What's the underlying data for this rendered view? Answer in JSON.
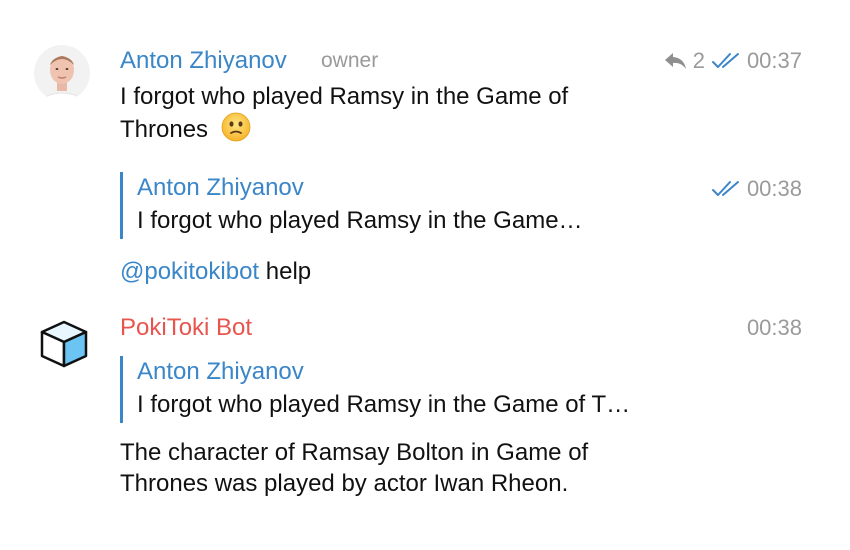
{
  "messages": [
    {
      "author": "Anton Zhiyanov",
      "role": "owner",
      "reply_count": "2",
      "time": "00:37",
      "text_line1": "I forgot who played Ramsy in the Game of",
      "text_line2": "Thrones",
      "emoji": "confused-face-emoji"
    },
    {
      "time": "00:38",
      "quote_author": "Anton Zhiyanov",
      "quote_text": "I forgot who played Ramsy in the Game…",
      "mention": "@pokitokibot",
      "text": " help"
    },
    {
      "author": "PokiToki Bot",
      "time": "00:38",
      "quote_author": "Anton Zhiyanov",
      "quote_text": "I forgot who played Ramsy in the Game of T…",
      "text_line1": "The character of Ramsay Bolton in Game of",
      "text_line2": "Thrones was played by actor Iwan Rheon."
    }
  ],
  "icons": {
    "reply": "reply-arrow-icon",
    "read": "double-check-icon",
    "bot_avatar": "cube-icon"
  },
  "colors": {
    "link_blue": "#3a86c8",
    "bot_red": "#e8554e",
    "meta_gray": "#9a9a9a"
  }
}
